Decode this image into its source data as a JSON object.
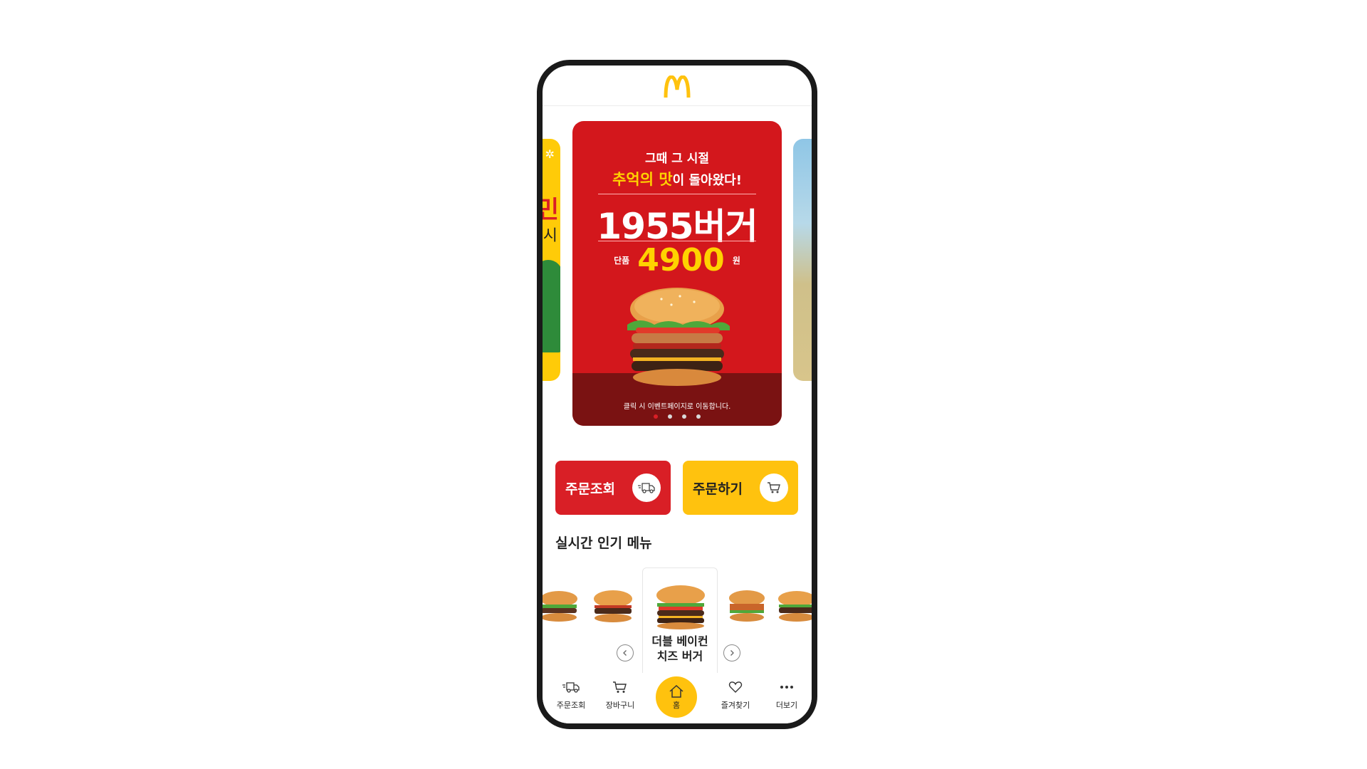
{
  "header": {
    "logo_icon": "mcdonalds-golden-arches-logo"
  },
  "carousel": {
    "left_peek": {
      "text1": "민",
      "text2": "시"
    },
    "banner": {
      "line1": "그때 그 시절",
      "line2_highlight": "추억의 맛",
      "line2_rest": "이 돌아왔다!",
      "title": "1955버거",
      "price_label": "단품",
      "price": "4900",
      "currency": "원",
      "note": "클릭 시 이벤트페이지로 이동합니다."
    },
    "active_index": 0,
    "count": 4
  },
  "actions": {
    "order_status_label": "주문조회",
    "order_status_icon": "delivery-truck-icon",
    "order_now_label": "주문하기",
    "order_now_icon": "cart-icon"
  },
  "popular": {
    "title": "실시간 인기 메뉴",
    "selected_name_line1": "더블 베이컨",
    "selected_name_line2": "치즈 버거"
  },
  "nav": {
    "items": [
      {
        "label": "주문조회",
        "icon": "delivery-truck-icon"
      },
      {
        "label": "장바구니",
        "icon": "cart-icon"
      },
      {
        "label": "홈",
        "icon": "home-icon"
      },
      {
        "label": "즐겨찾기",
        "icon": "heart-icon"
      },
      {
        "label": "더보기",
        "icon": "more-dots-icon"
      }
    ]
  },
  "colors": {
    "brand_red": "#d91f26",
    "brand_yellow": "#ffc20e",
    "banner_red": "#d3171c"
  }
}
